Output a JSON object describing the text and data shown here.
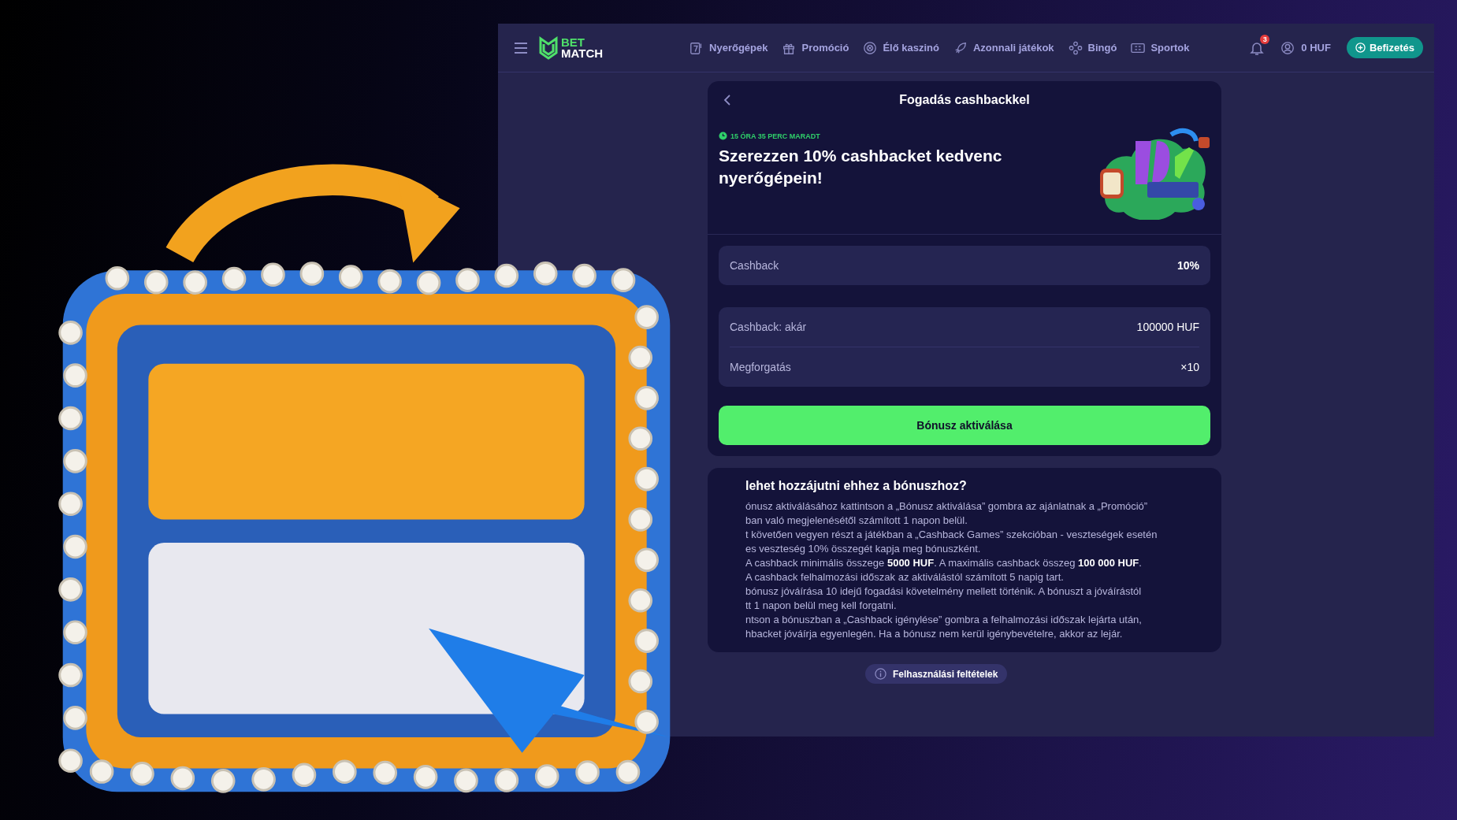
{
  "nav": {
    "logo": {
      "top": "BET",
      "bottom": "MATCH"
    },
    "items": [
      {
        "label": "Nyerőgépek"
      },
      {
        "label": "Promóció"
      },
      {
        "label": "Élő kaszinó"
      },
      {
        "label": "Azonnali játékok"
      },
      {
        "label": "Bingó"
      },
      {
        "label": "Sportok"
      }
    ],
    "notification_count": "3",
    "balance": "0 HUF",
    "deposit_button": "Befizetés"
  },
  "bonus_card": {
    "title": "Fogadás cashbackkel",
    "timer": "15 ÓRA 35 PERC MARADT",
    "headline": "Szerezzen 10% cashbacket kedvenc nyerőgépein!",
    "summary": [
      {
        "label": "Cashback",
        "value": "10%"
      }
    ],
    "details": [
      {
        "label": "Cashback: akár",
        "value": "100000 HUF"
      },
      {
        "label": "Megforgatás",
        "value": "×10"
      }
    ],
    "activate_button": "Bónusz aktiválása"
  },
  "how_to": {
    "heading": "lehet hozzájutni ehhez a bónuszhoz?",
    "lines": [
      "ónusz aktiválásához kattintson a „Bónusz aktiválása” gombra az ajánlatnak a „Promóció”",
      "ban való megjelenésétől számított 1 napon belül.",
      "t követően vegyen részt a játékban a „Cashback Games” szekcióban - veszteségek esetén",
      "es veszteség 10% összegét kapja meg bónuszként.",
      "A cashback minimális összege **5000 HUF**. A maximális cashback összeg **100 000 HUF**.",
      "A cashback felhalmozási időszak az aktiválástól számított 5 napig tart.",
      "bónusz jóváírása 10 idejű fogadási követelmény mellett történik. A bónuszt a jóváírástól",
      "tt 1 napon belül meg kell forgatni.",
      "ntson a bónuszban a „Cashback igénylése” gombra a felhalmozási időszak lejárta után,",
      "hbacket jóváírja egyenlegén. Ha a bónusz nem kerül igénybevételre, akkor az lejár."
    ]
  },
  "terms_button": "Felhasználási feltételek"
}
